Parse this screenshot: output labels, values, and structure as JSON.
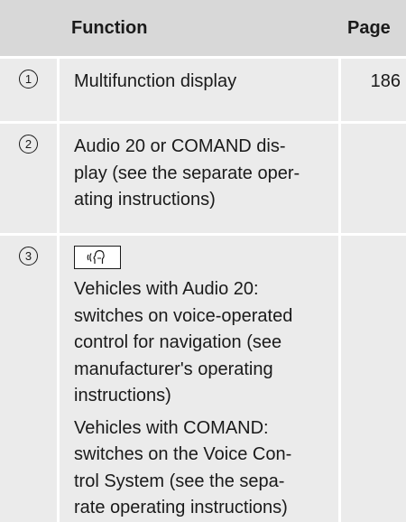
{
  "header": {
    "number_col": "",
    "function_col": "Function",
    "page_col": "Page"
  },
  "rows": [
    {
      "number": "1",
      "function": "Multifunction display",
      "page": "186"
    },
    {
      "number": "2",
      "function": "Audio 20 or COMAND dis-\nplay (see the separate oper-\nating instructions)",
      "page": ""
    },
    {
      "number": "3",
      "key_icon": "voice-control-key-icon",
      "paragraph_1": "Vehicles with Audio 20:\nswitches on voice-operated\ncontrol for navigation (see\nmanufacturer's operating\ninstructions)",
      "paragraph_2": "Vehicles with COMAND:\nswitches on the Voice Con-\ntrol System (see the sepa-\nrate operating instructions)",
      "page": ""
    }
  ],
  "colors": {
    "header_bg": "#d8d8d8",
    "row_bg": "#ebebeb",
    "text": "#1a1a1a"
  }
}
